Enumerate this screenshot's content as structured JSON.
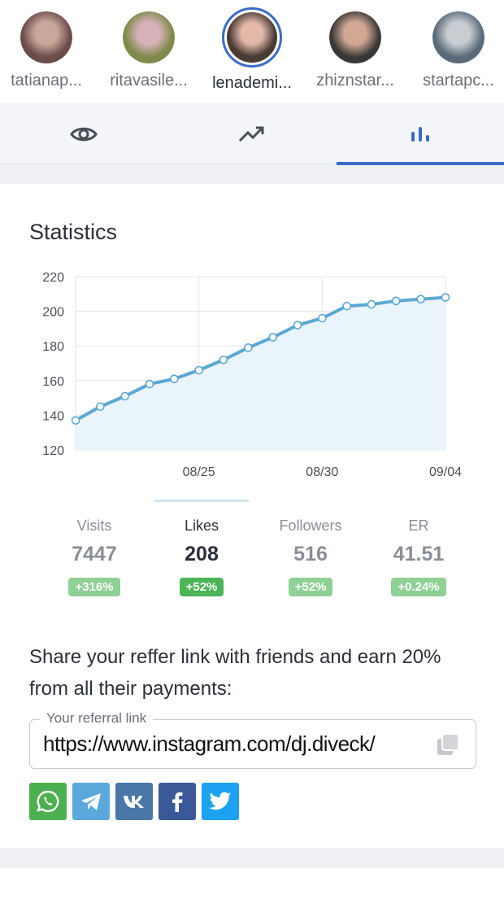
{
  "stories": [
    {
      "name": "tatianap...",
      "colors": [
        "#6b4c4a",
        "#c9a89c"
      ]
    },
    {
      "name": "ritavasile...",
      "colors": [
        "#7e8a4a",
        "#d8b0b8"
      ]
    },
    {
      "name": "lenademi...",
      "colors": [
        "#4a3a34",
        "#e2b8a8"
      ],
      "active": true
    },
    {
      "name": "zhiznstar...",
      "colors": [
        "#3a3836",
        "#d2a894"
      ]
    },
    {
      "name": "startapc...",
      "colors": [
        "#5a6a78",
        "#c8cdd2"
      ]
    }
  ],
  "tabs": [
    {
      "icon": "eye-icon"
    },
    {
      "icon": "trending-up-icon"
    },
    {
      "icon": "bar-chart-icon",
      "active": true
    }
  ],
  "statistics": {
    "title": "Statistics"
  },
  "chart_data": {
    "type": "area",
    "title": "",
    "xlabel": "",
    "ylabel": "",
    "ylim": [
      120,
      220
    ],
    "yticks": [
      120,
      140,
      160,
      180,
      200,
      220
    ],
    "xticks": [
      {
        "index": 5,
        "label": "08/25"
      },
      {
        "index": 10,
        "label": "08/30"
      },
      {
        "index": 15,
        "label": "09/04"
      }
    ],
    "values": [
      137,
      145,
      151,
      158,
      161,
      166,
      172,
      179,
      185,
      192,
      196,
      203,
      204,
      206,
      207,
      208
    ],
    "grid": true,
    "line_color": "#5ba8d4",
    "fill_color": "#eaf4fb"
  },
  "stats": [
    {
      "label": "Visits",
      "value": "7447",
      "change": "+316%"
    },
    {
      "label": "Likes",
      "value": "208",
      "change": "+52%",
      "active": true
    },
    {
      "label": "Followers",
      "value": "516",
      "change": "+52%"
    },
    {
      "label": "ER",
      "value": "41.51",
      "change": "+0.24%"
    }
  ],
  "share": {
    "text": "Share your reffer link with friends and earn 20% from all their payments:",
    "ref_label": "Your referral link",
    "ref_value": "https://www.instagram.com/dj.diveck/"
  },
  "socials": [
    {
      "icon": "whatsapp-icon",
      "color": "#4caf50"
    },
    {
      "icon": "telegram-icon",
      "color": "#5aa8dc"
    },
    {
      "icon": "vk-icon",
      "color": "#4a76a8"
    },
    {
      "icon": "facebook-icon",
      "color": "#3b5998"
    },
    {
      "icon": "twitter-icon",
      "color": "#1da1f2"
    }
  ],
  "colors": {
    "accent": "#3b6cc9"
  }
}
